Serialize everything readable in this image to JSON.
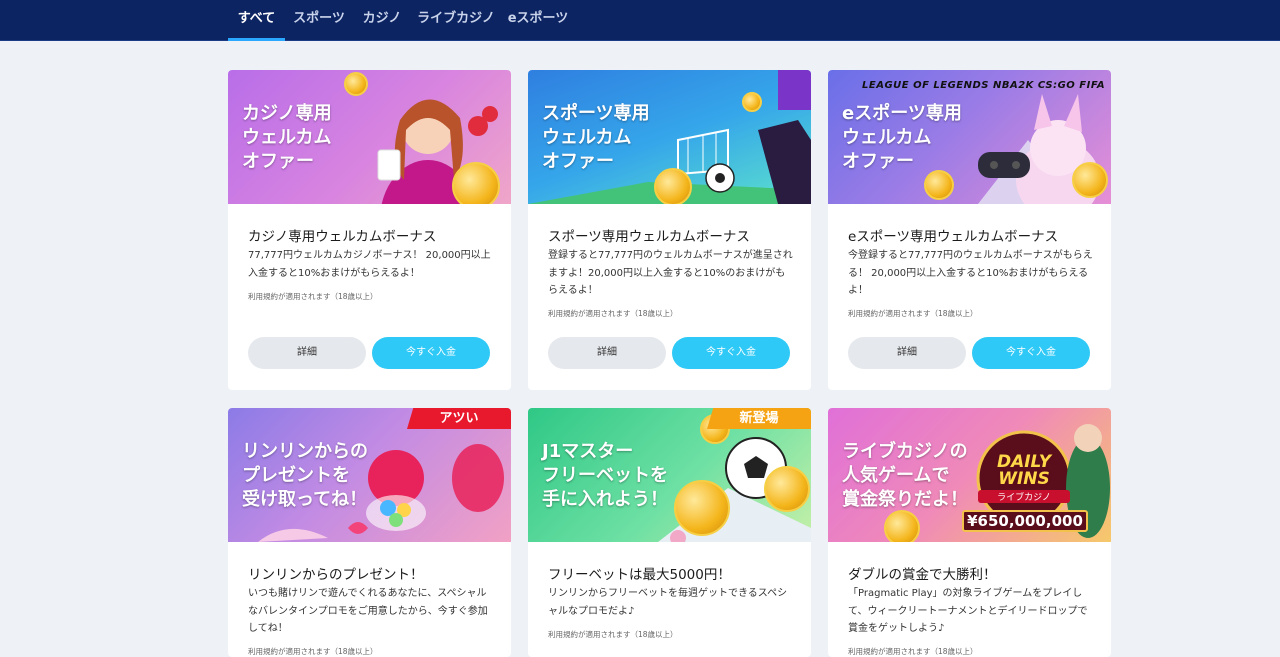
{
  "nav": {
    "tabs": [
      {
        "label": "すべて",
        "active": true
      },
      {
        "label": "スポーツ",
        "active": false
      },
      {
        "label": "カジノ",
        "active": false
      },
      {
        "label": "ライブカジノ",
        "active": false
      },
      {
        "label": "eスポーツ",
        "active": false
      }
    ]
  },
  "promotions": [
    {
      "banner_text": "カジノ専用\nウェルカム\nオファー",
      "title": "カジノ専用ウェルカムボーナス",
      "description": "77,777円ウェルカムカジノボーナス！ 20,000円以上入金すると10%おまけがもらえるよ！",
      "terms": "利用規約が適用されます（18歳以上）",
      "detail_label": "詳細",
      "deposit_label": "今すぐ入金"
    },
    {
      "banner_text": "スポーツ専用\nウェルカム\nオファー",
      "title": "スポーツ専用ウェルカムボーナス",
      "description": "登録すると77,777円のウェルカムボーナスが進呈されますよ！20,000円以上入金すると10%のおまけがもらえるよ！",
      "terms": "利用規約が適用されます（18歳以上）",
      "detail_label": "詳細",
      "deposit_label": "今すぐ入金"
    },
    {
      "banner_text": "eスポーツ専用\nウェルカム\nオファー",
      "banner_logos": "LEAGUE OF LEGENDS   NBA2K  CS:GO  FIFA",
      "title": "eスポーツ専用ウェルカムボーナス",
      "description": "今登録すると77,777円のウェルカムボーナスがもらえる！ 20,000円以上入金すると10%おまけがもらえるよ！",
      "terms": "利用規約が適用されます（18歳以上）",
      "detail_label": "詳細",
      "deposit_label": "今すぐ入金"
    },
    {
      "banner_text": "リンリンからの\nプレゼントを\n受け取ってね！",
      "ribbon": "アツい",
      "title": "リンリンからのプレゼント！",
      "description": "いつも賭けリンで遊んでくれるあなたに、スペシャルなバレンタインプロモをご用意したから、今すぐ参加してね！",
      "terms": "利用規約が適用されます（18歳以上）"
    },
    {
      "banner_text": "J1マスター\nフリーベットを\n手に入れよう！",
      "ribbon": "新登場",
      "title": "フリーベットは最大5000円！",
      "description": "リンリンからフリーベットを毎週ゲットできるスペシャルなプロモだよ♪",
      "terms": "利用規約が適用されます（18歳以上）"
    },
    {
      "banner_text": "ライブカジノの\n人気ゲームで\n賞金祭りだよ！",
      "banner_badge_top": "DAILY WINS",
      "banner_badge_sub": "ライブカジノ",
      "banner_badge_amount": "¥650,000,000",
      "title": "ダブルの賞金で大勝利！",
      "description": "「Pragmatic Play」の対象ライブゲームをプレイして、ウィークリートーナメントとデイリードロップで賞金をゲットしよう♪",
      "terms": "利用規約が適用されます（18歳以上）"
    }
  ],
  "colors": {
    "nav_bg": "#0d2463",
    "accent": "#2ec9f6",
    "ribbon_hot": "#e8192c",
    "ribbon_new": "#f5a313"
  }
}
